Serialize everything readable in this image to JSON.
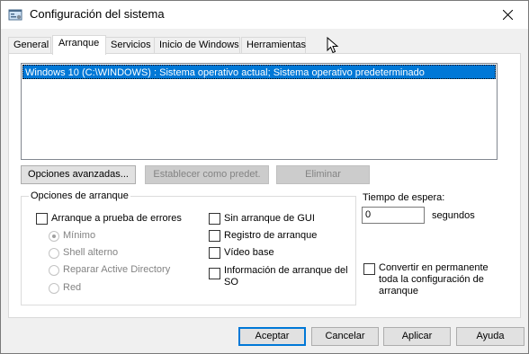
{
  "window": {
    "title": "Configuración del sistema",
    "icon": "msconfig-icon"
  },
  "tabs": [
    {
      "label": "General"
    },
    {
      "label": "Arranque",
      "active": true
    },
    {
      "label": "Servicios"
    },
    {
      "label": "Inicio de Windows"
    },
    {
      "label": "Herramientas"
    }
  ],
  "boot_list": {
    "items": [
      "Windows 10 (C:\\WINDOWS) : Sistema operativo actual; Sistema operativo predeterminado"
    ],
    "selected_index": 0
  },
  "boot_buttons": {
    "advanced": "Opciones avanzadas...",
    "set_default": "Establecer como predet.",
    "delete": "Eliminar"
  },
  "boot_options": {
    "legend": "Opciones de arranque",
    "safe_boot": {
      "label": "Arranque a prueba de errores",
      "checked": false
    },
    "safe_modes": [
      {
        "label": "Mínimo",
        "selected": true
      },
      {
        "label": "Shell alterno",
        "selected": false
      },
      {
        "label": "Reparar Active Directory",
        "selected": false
      },
      {
        "label": "Red",
        "selected": false
      }
    ],
    "no_gui": {
      "label": "Sin arranque de GUI",
      "checked": false
    },
    "boot_log": {
      "label": "Registro de arranque",
      "checked": false
    },
    "base_video": {
      "label": "Vídeo base",
      "checked": false
    },
    "os_boot_info": {
      "label": "Información de arranque del SO",
      "checked": false
    }
  },
  "timeout": {
    "label": "Tiempo de espera:",
    "value": "0",
    "unit": "segundos"
  },
  "make_permanent": {
    "label": "Convertir en permanente toda la configuración de arranque",
    "checked": false
  },
  "dialog_buttons": {
    "ok": "Aceptar",
    "cancel": "Cancelar",
    "apply": "Aplicar",
    "help": "Ayuda"
  },
  "colors": {
    "selection": "#0078d7",
    "dialog_bg": "#f0f0f0"
  }
}
